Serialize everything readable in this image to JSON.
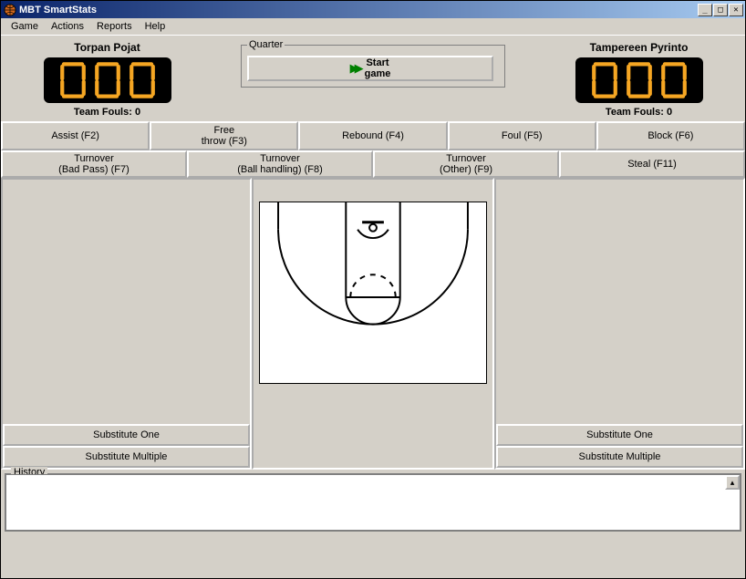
{
  "window": {
    "title": "MBT SmartStats"
  },
  "menu": {
    "items": [
      "Game",
      "Actions",
      "Reports",
      "Help"
    ]
  },
  "quarter": {
    "legend": "Quarter",
    "start_line1": "Start",
    "start_line2": "game"
  },
  "team_left": {
    "name": "Torpan Pojat",
    "score_digits": [
      "0",
      "0",
      "0"
    ],
    "fouls_label": "Team Fouls: 0",
    "sub_one": "Substitute One",
    "sub_multi": "Substitute Multiple"
  },
  "team_right": {
    "name": "Tampereen Pyrinto",
    "score_digits": [
      "0",
      "0",
      "0"
    ],
    "fouls_label": "Team Fouls: 0",
    "sub_one": "Substitute One",
    "sub_multi": "Substitute Multiple"
  },
  "stats_row1": [
    "Assist (F2)",
    "Free\nthrow (F3)",
    "Rebound (F4)",
    "Foul (F5)",
    "Block (F6)"
  ],
  "stats_row2": [
    "Turnover\n(Bad Pass) (F7)",
    "Turnover\n(Ball handling) (F8)",
    "Turnover\n(Other) (F9)",
    "Steal (F11)"
  ],
  "history": {
    "label": "History"
  }
}
